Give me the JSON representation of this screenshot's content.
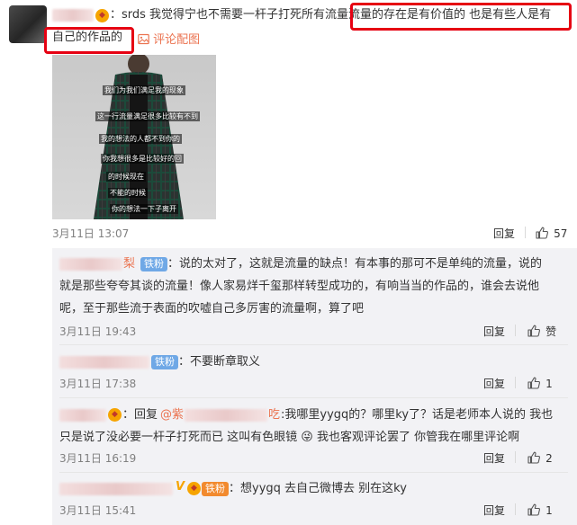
{
  "main_comment": {
    "prefix": "：srds 我觉得宁也不需要一杆子打死所有流量",
    "highlighted": "流量的存在是有价值的 也是有些人是有",
    "line2_highlighted": "自己的作品的",
    "image_link_label": "评论配图",
    "image_captions": [
      "我们为我们满足我的现象",
      "这一行流量满足很多比较有不到",
      "我的想法的人都不到你的",
      "你我想很多是比较好的回",
      "的时候现在",
      "不能的时候",
      "你的想法一下子离开"
    ],
    "timestamp": "3月11日 13:07",
    "reply_label": "回复",
    "like_count": "57"
  },
  "replies": [
    {
      "name_tail": "梨",
      "badge": "铁粉",
      "lines": [
        "：说的太对了，这就是流量的缺点！有本事的那可不是单纯的流量，说的",
        "就是那些夸夸其谈的流量！像人家易烊千玺那样转型成功的，有响当当的作品的，谁会去说他",
        "呢，至于那些流于表面的吹嘘自己多厉害的流量啊，算了吧"
      ],
      "timestamp": "3月11日 19:43",
      "reply_label": "回复",
      "like_label": "赞"
    },
    {
      "badge": "铁粉",
      "lines": [
        "：不要断章取义"
      ],
      "timestamp": "3月11日 17:38",
      "reply_label": "回复",
      "like_count": "1"
    },
    {
      "reply_prefix": "：回复",
      "mention_start": "@紫",
      "mention_end": "吃",
      "line1_rest": ":我哪里yygq的？哪里ky了？话是老师本人说的 我也",
      "line2": "只是说了没必要一杆子打死而已 这叫有色眼镜",
      "emoji": "😜",
      "line2_rest": "我也客观评论罢了 你管我在哪里评论啊",
      "timestamp": "3月11日 16:19",
      "reply_label": "回复",
      "like_count": "2"
    },
    {
      "v_mark": "V",
      "badge": "铁粉",
      "lines": [
        "：想yygq 去自己微博去 别在这ky"
      ],
      "timestamp": "3月11日 15:41",
      "reply_label": "回复",
      "like_count": "1"
    }
  ],
  "colors": {
    "highlight_box": "#e60012",
    "link": "#eb7350",
    "fan_badge": "#6fa8e6",
    "sub_bg": "#f2f2f5"
  },
  "icons": {
    "like": "thumb-up-icon",
    "image": "picture-icon"
  }
}
